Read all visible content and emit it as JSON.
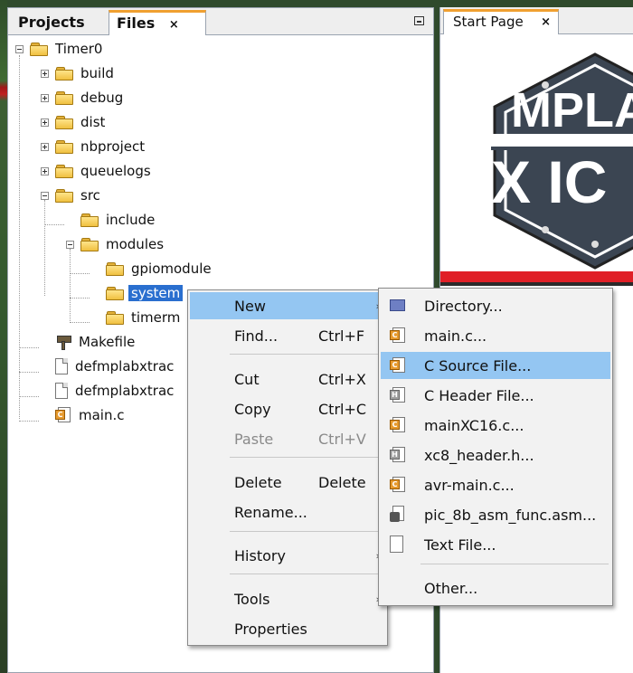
{
  "left_panel": {
    "tabs": [
      {
        "label": "Projects"
      },
      {
        "label": "Files",
        "close": "×"
      }
    ],
    "tree": {
      "root": "Timer0",
      "items": [
        {
          "label": "build"
        },
        {
          "label": "debug"
        },
        {
          "label": "dist"
        },
        {
          "label": "nbproject"
        },
        {
          "label": "queuelogs"
        },
        {
          "label": "src"
        },
        {
          "label": "include"
        },
        {
          "label": "modules"
        },
        {
          "label": "gpiomodule"
        },
        {
          "label": "systemmodule"
        },
        {
          "label": "timermodule"
        },
        {
          "label": "Makefile"
        },
        {
          "label": "defmplabxtrace.log"
        },
        {
          "label": "defmplabxtrace.log.inx"
        },
        {
          "label": "main.c"
        }
      ],
      "visible_text": {
        "system": "system",
        "timer": "timerm",
        "defA": "defmplabxtrac",
        "defB": "defmplabxtrac"
      }
    }
  },
  "right_panel": {
    "tab": {
      "label": "Start Page",
      "close": "×"
    },
    "logo_text": [
      "MPLA",
      "X IC"
    ]
  },
  "context_menu": {
    "items": [
      {
        "label": "New",
        "shortcut": "",
        "arrow": "›"
      },
      {
        "label": "Find...",
        "shortcut": "Ctrl+F"
      },
      {
        "label": "Cut",
        "shortcut": "Ctrl+X"
      },
      {
        "label": "Copy",
        "shortcut": "Ctrl+C"
      },
      {
        "label": "Paste",
        "shortcut": "Ctrl+V",
        "disabled": true
      },
      {
        "label": "Delete",
        "shortcut": "Delete"
      },
      {
        "label": "Rename...",
        "shortcut": ""
      },
      {
        "label": "History",
        "shortcut": "",
        "arrow": "›"
      },
      {
        "label": "Tools",
        "shortcut": "",
        "arrow": "›"
      },
      {
        "label": "Properties",
        "shortcut": ""
      }
    ]
  },
  "new_submenu": {
    "items": [
      {
        "label": "Directory...",
        "icon": "directory-icon"
      },
      {
        "label": "main.c...",
        "icon": "c-file-icon"
      },
      {
        "label": "C Source File...",
        "icon": "c-file-icon"
      },
      {
        "label": "C Header File...",
        "icon": "h-file-icon"
      },
      {
        "label": "mainXC16.c...",
        "icon": "c-file-icon"
      },
      {
        "label": "xc8_header.h...",
        "icon": "h-file-icon"
      },
      {
        "label": "avr-main.c...",
        "icon": "c-file-icon"
      },
      {
        "label": "pic_8b_asm_func.asm...",
        "icon": "asm-file-icon"
      },
      {
        "label": "Text File...",
        "icon": "text-file-icon"
      },
      {
        "label": "Other...",
        "icon": ""
      }
    ]
  },
  "colors": {
    "selection": "#2a6fcf",
    "menu_highlight": "#94c6f2",
    "tab_accent": "#f0a030",
    "logo_red": "#e01f26"
  }
}
